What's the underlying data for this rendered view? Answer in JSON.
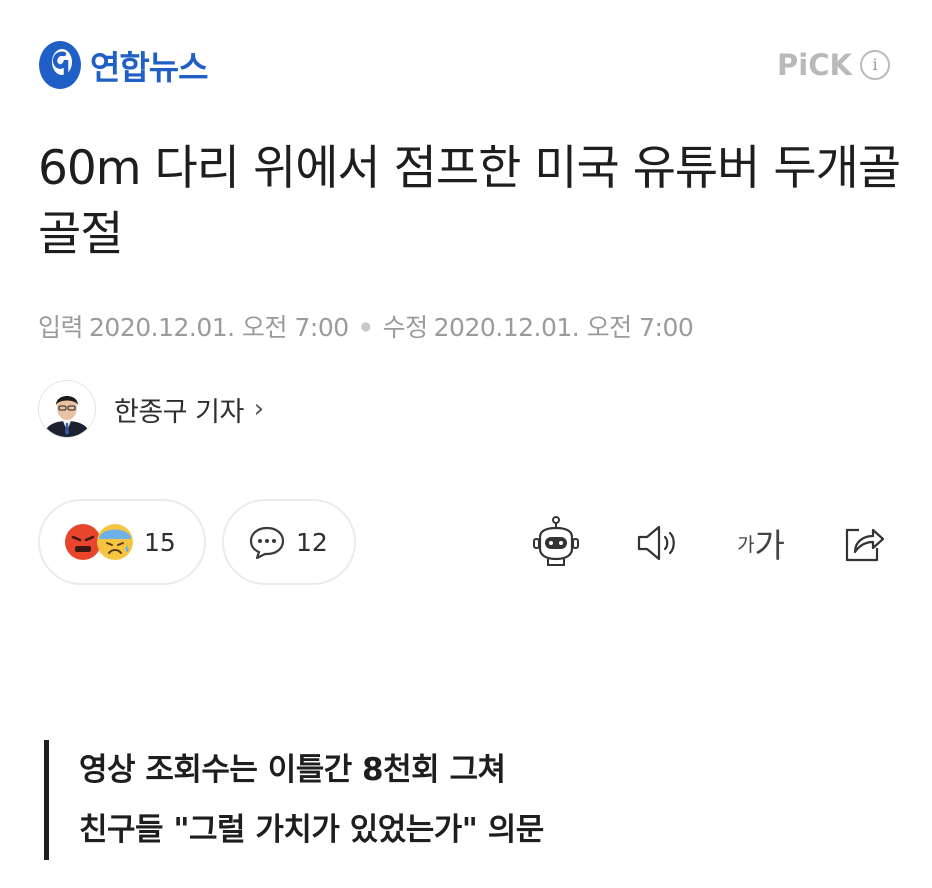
{
  "header": {
    "logo_text": "연합뉴스",
    "pick_label": "PiCK",
    "info_icon": "i"
  },
  "article": {
    "title": "60m 다리 위에서 점프한 미국 유튜버 두개골 골절",
    "input_label": "입력",
    "input_time": "2020.12.01. 오전 7:00",
    "modified_label": "수정",
    "modified_time": "2020.12.01. 오전 7:00",
    "author": "한종구 기자",
    "author_chevron": "›"
  },
  "actions": {
    "reaction_count": "15",
    "comment_count": "12",
    "font_small": "가",
    "font_large": "가"
  },
  "icons": {
    "reactions": [
      "angry-face-icon",
      "sad-sweat-face-icon"
    ],
    "comment": "speech-bubble-icon",
    "toolbar": [
      "robot-summary-icon",
      "speaker-icon",
      "font-size-icon",
      "share-icon"
    ]
  },
  "subheading": {
    "line1": "영상 조회수는 이틀간 8천회 그쳐",
    "line2": "친구들 \"그럴 가치가 있었는가\" 의문"
  },
  "colors": {
    "brand_blue": "#1f5fc6",
    "pick_gray": "#b9b9b9",
    "angry_red": "#e8452c",
    "sad_yellow": "#f5c542",
    "text": "#1e1e1e"
  }
}
